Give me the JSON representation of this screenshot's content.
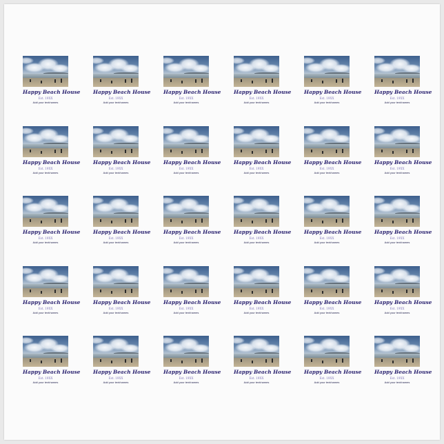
{
  "sticker": {
    "title": "Happy Beach House",
    "established": "Est. 19XX",
    "names": "Add your text/names"
  },
  "sheet": {
    "rows": 5,
    "columns": 6
  },
  "colors": {
    "title": "#2a2270",
    "established": "#7d73b8",
    "names": "#1d1d4a",
    "paper": "#fbfbfb"
  }
}
